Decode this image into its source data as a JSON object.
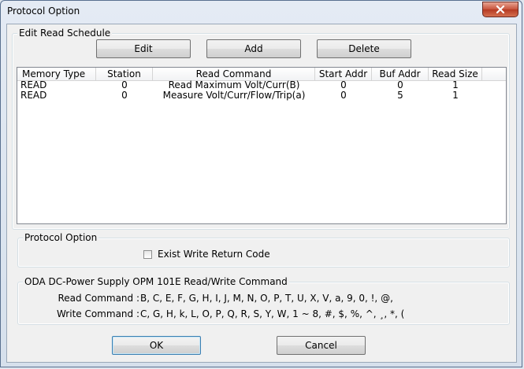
{
  "window": {
    "title": "Protocol Option"
  },
  "schedule": {
    "group_label": "Edit Read Schedule",
    "edit_label": "Edit",
    "add_label": "Add",
    "delete_label": "Delete",
    "columns": [
      "Memory Type",
      "Station",
      "Read Command",
      "Start Addr",
      "Buf Addr",
      "Read Size"
    ],
    "rows": [
      [
        "READ",
        "0",
        "Read Maximum Volt/Curr(B)",
        "0",
        "0",
        "1"
      ],
      [
        "READ",
        "0",
        "Measure Volt/Curr/Flow/Trip(a)",
        "0",
        "5",
        "1"
      ]
    ]
  },
  "protocol": {
    "group_label": "Protocol Option",
    "checkbox_label": "Exist Write Return Code",
    "checked": false
  },
  "commands": {
    "group_label": "ODA DC-Power Supply OPM 101E Read/Write Command",
    "read_label": "Read Command :",
    "read_value": "B, C, E, F, G, H, I, J, M, N, O, P, T, U, X, V, a, 9, 0, !, @,",
    "write_label": "Write Command :",
    "write_value": "C, G, H, k, L, O, P, Q, R, S, Y, W, 1 ~ 8, #, $, %, ^, ¸, *, ("
  },
  "footer": {
    "ok_label": "OK",
    "cancel_label": "Cancel"
  }
}
